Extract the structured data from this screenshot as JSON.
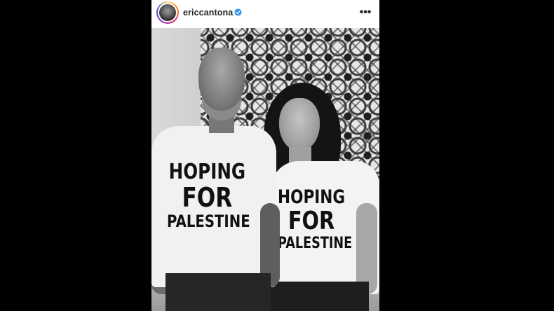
{
  "post": {
    "username": "ericcantona",
    "verified": true,
    "more_icon": "more-horizontal-icon",
    "more_label": "•••",
    "accent_verified": "#3897f0"
  },
  "photo": {
    "man_shirt": {
      "line1": "HOPING",
      "line2": "FOR",
      "line3": "PALESTINE"
    },
    "woman_shirt": {
      "line1": "HOPING",
      "line2": "FOR",
      "line3": "PALESTINE"
    }
  }
}
